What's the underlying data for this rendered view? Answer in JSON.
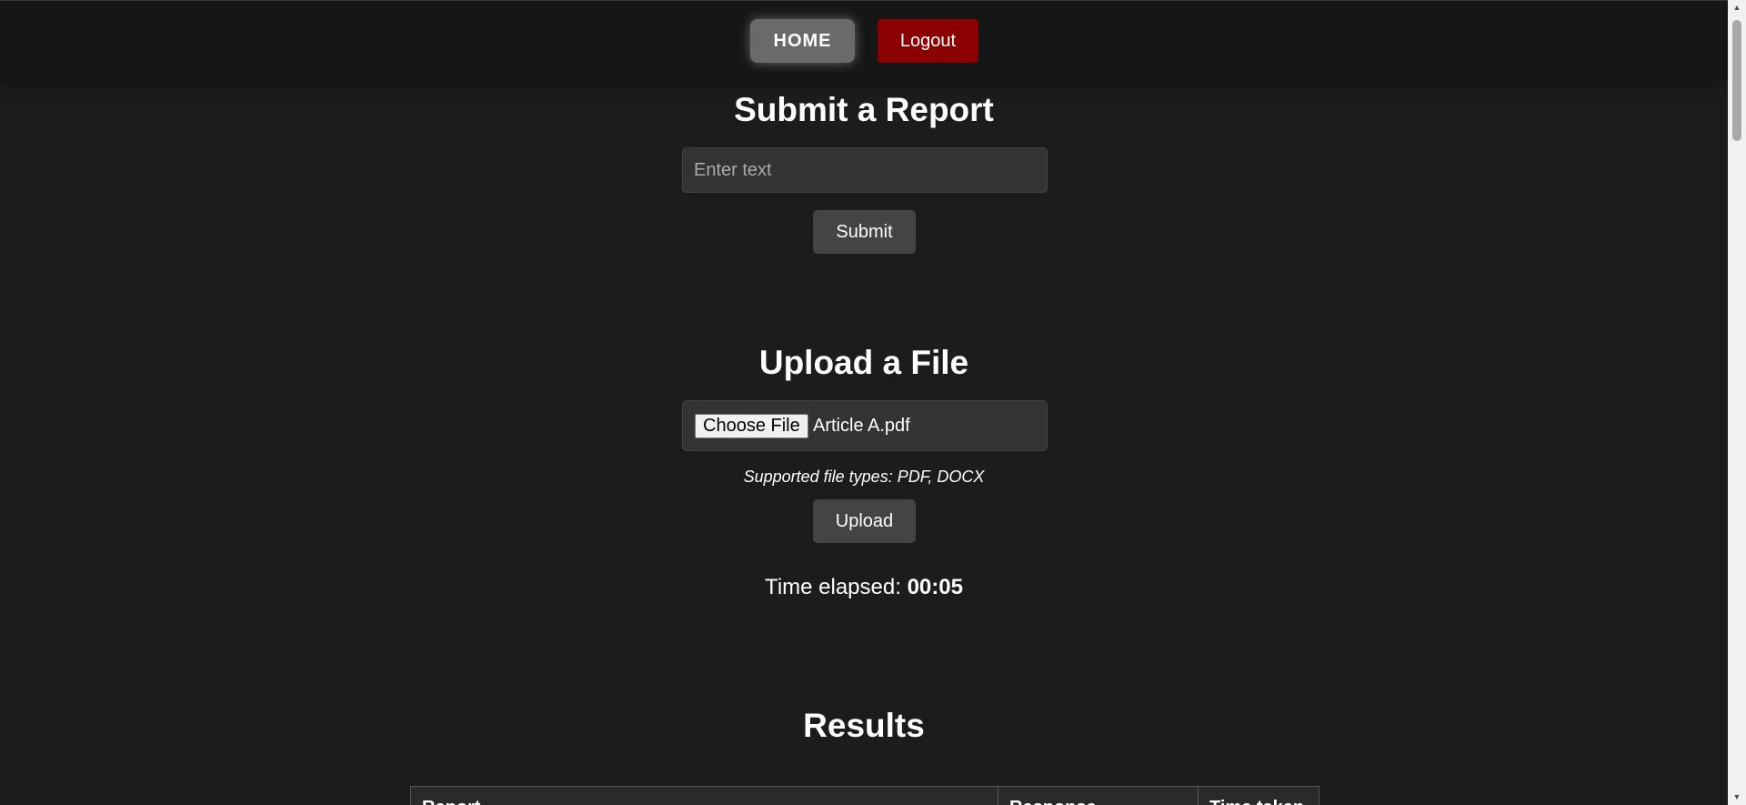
{
  "nav": {
    "home_label": "HOME",
    "logout_label": "Logout",
    "logout_color": "#8b0000"
  },
  "report": {
    "title": "Submit a Report",
    "input_placeholder": "Enter text",
    "input_value": "",
    "submit_label": "Submit"
  },
  "upload": {
    "title": "Upload a File",
    "choose_label": "Choose File",
    "file_name": "Article A.pdf",
    "hint": "Supported file types: PDF, DOCX",
    "upload_label": "Upload"
  },
  "timer": {
    "label": "Time elapsed: ",
    "value": "00:05"
  },
  "results": {
    "title": "Results",
    "columns": [
      "Report",
      "Response",
      "Time taken"
    ]
  },
  "scrollbar": {
    "up_icon": "scroll-up-arrow-icon",
    "down_icon": "scroll-down-arrow-icon"
  }
}
